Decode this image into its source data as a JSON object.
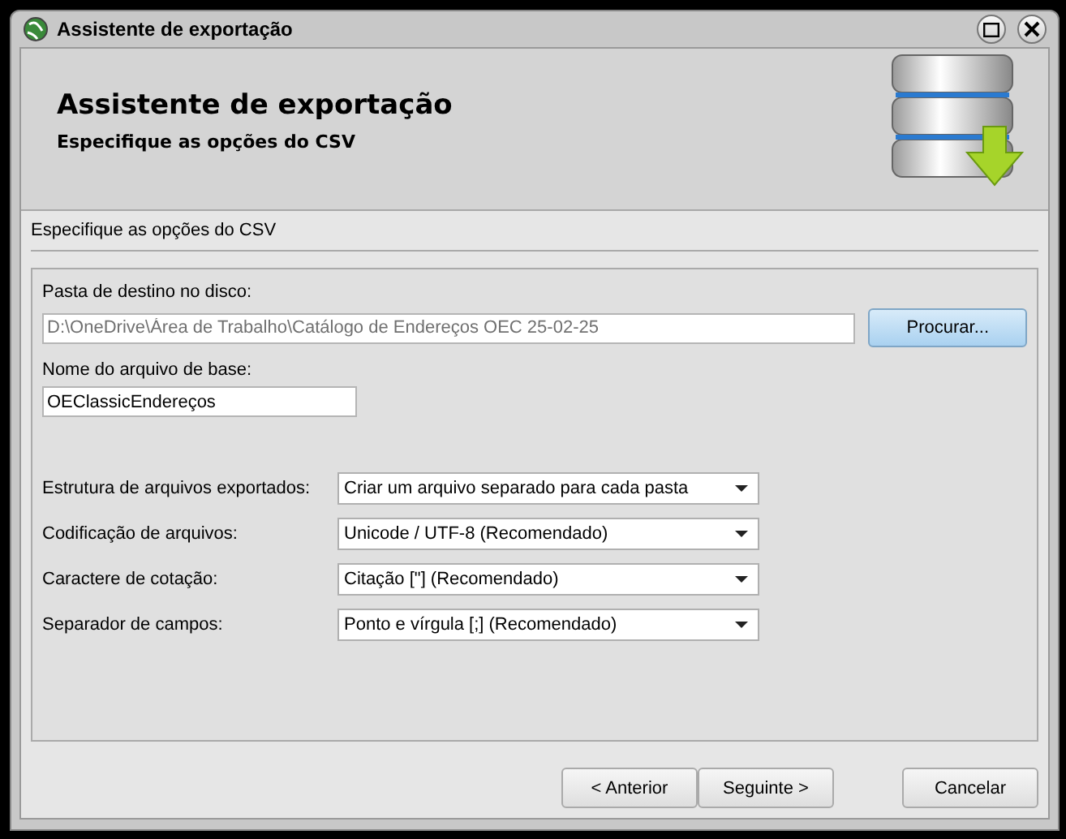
{
  "window": {
    "title": "Assistente de exportação"
  },
  "header": {
    "title": "Assistente de exportação",
    "subtitle": "Especifique as opções do CSV"
  },
  "section_title": "Especifique as opções do CSV",
  "destination": {
    "label": "Pasta de destino no disco:",
    "value": "D:\\OneDrive\\Área de Trabalho\\Catálogo de Endereços OEC 25-02-25",
    "disabled": true,
    "button": "Procurar..."
  },
  "base_name": {
    "label": "Nome do arquivo de base:",
    "value": "OEClassicEndereços"
  },
  "options": [
    {
      "label": "Estrutura de arquivos exportados:",
      "value": "Criar um arquivo separado para cada pasta"
    },
    {
      "label": "Codificação de arquivos:",
      "value": "Unicode / UTF-8 (Recomendado)"
    },
    {
      "label": "Caractere de cotação:",
      "value": "Citação [\"] (Recomendado)"
    },
    {
      "label": "Separador de campos:",
      "value": "Ponto e vírgula [;] (Recomendado)"
    }
  ],
  "buttons": [
    {
      "label": "< Anterior",
      "kind": "back"
    },
    {
      "label": "Seguinte >",
      "kind": "next"
    },
    {
      "label": "Cancelar",
      "kind": "cancel"
    }
  ]
}
